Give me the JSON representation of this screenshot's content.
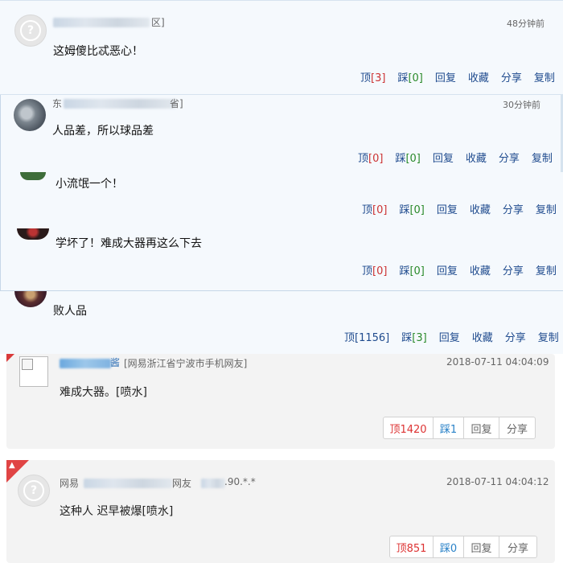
{
  "thread": [
    {
      "name_suffix": "区]",
      "time": "48分钟前",
      "content": "这姆傻比忒恶心！",
      "actions": {
        "up": "顶",
        "up_count": "[3]",
        "down": "踩",
        "down_count": "[0]",
        "reply": "回复",
        "fav": "收藏",
        "share": "分享",
        "copy": "复制"
      }
    },
    {
      "name_prefix": "东",
      "name_suffix": "省]",
      "time": "30分钟前",
      "content": "人品差，所以球品差",
      "actions": {
        "up": "顶",
        "up_count": "[0]",
        "down": "踩",
        "down_count": "[0]",
        "reply": "回复",
        "fav": "收藏",
        "share": "分享",
        "copy": "复制"
      }
    },
    {
      "content": "小流氓一个！",
      "actions": {
        "up": "顶",
        "up_count": "[0]",
        "down": "踩",
        "down_count": "[0]",
        "reply": "回复",
        "fav": "收藏",
        "share": "分享",
        "copy": "复制"
      }
    },
    {
      "content": "学坏了！难成大器再这么下去",
      "actions": {
        "up": "顶",
        "up_count": "[0]",
        "down": "踩",
        "down_count": "[0]",
        "reply": "回复",
        "fav": "收藏",
        "share": "分享",
        "copy": "复制"
      }
    },
    {
      "content": "败人品",
      "actions": {
        "up": "顶",
        "up_count": "[1156]",
        "down": "踩",
        "down_count": "[3]",
        "reply": "回复",
        "fav": "收藏",
        "share": "分享",
        "copy": "复制"
      }
    }
  ],
  "cards": [
    {
      "name_end": "酱",
      "location": "[网易浙江省宁波市手机网友]",
      "time": "2018-07-11 04:04:09",
      "content": "难成大器。[喷水]",
      "vote": {
        "up": "顶1420",
        "down": "踩1",
        "reply": "回复",
        "share": "分享"
      }
    },
    {
      "name_start": "网易",
      "name_mid": "网友",
      "ip_tail": ".90.*.*",
      "time": "2018-07-11 04:04:12",
      "content": "这种人 迟早被爆[喷水]",
      "vote": {
        "up": "顶851",
        "down": "踩0",
        "reply": "回复",
        "share": "分享"
      }
    }
  ],
  "icons": {
    "default_avatar": "user-placeholder-icon",
    "hot_badge": "fire-icon",
    "broken_image": "broken-image-icon"
  },
  "colors": {
    "link": "#1f4b8e",
    "count_red": "#cc3333",
    "count_green": "#2a8a2a",
    "badge_red": "#e04444"
  }
}
